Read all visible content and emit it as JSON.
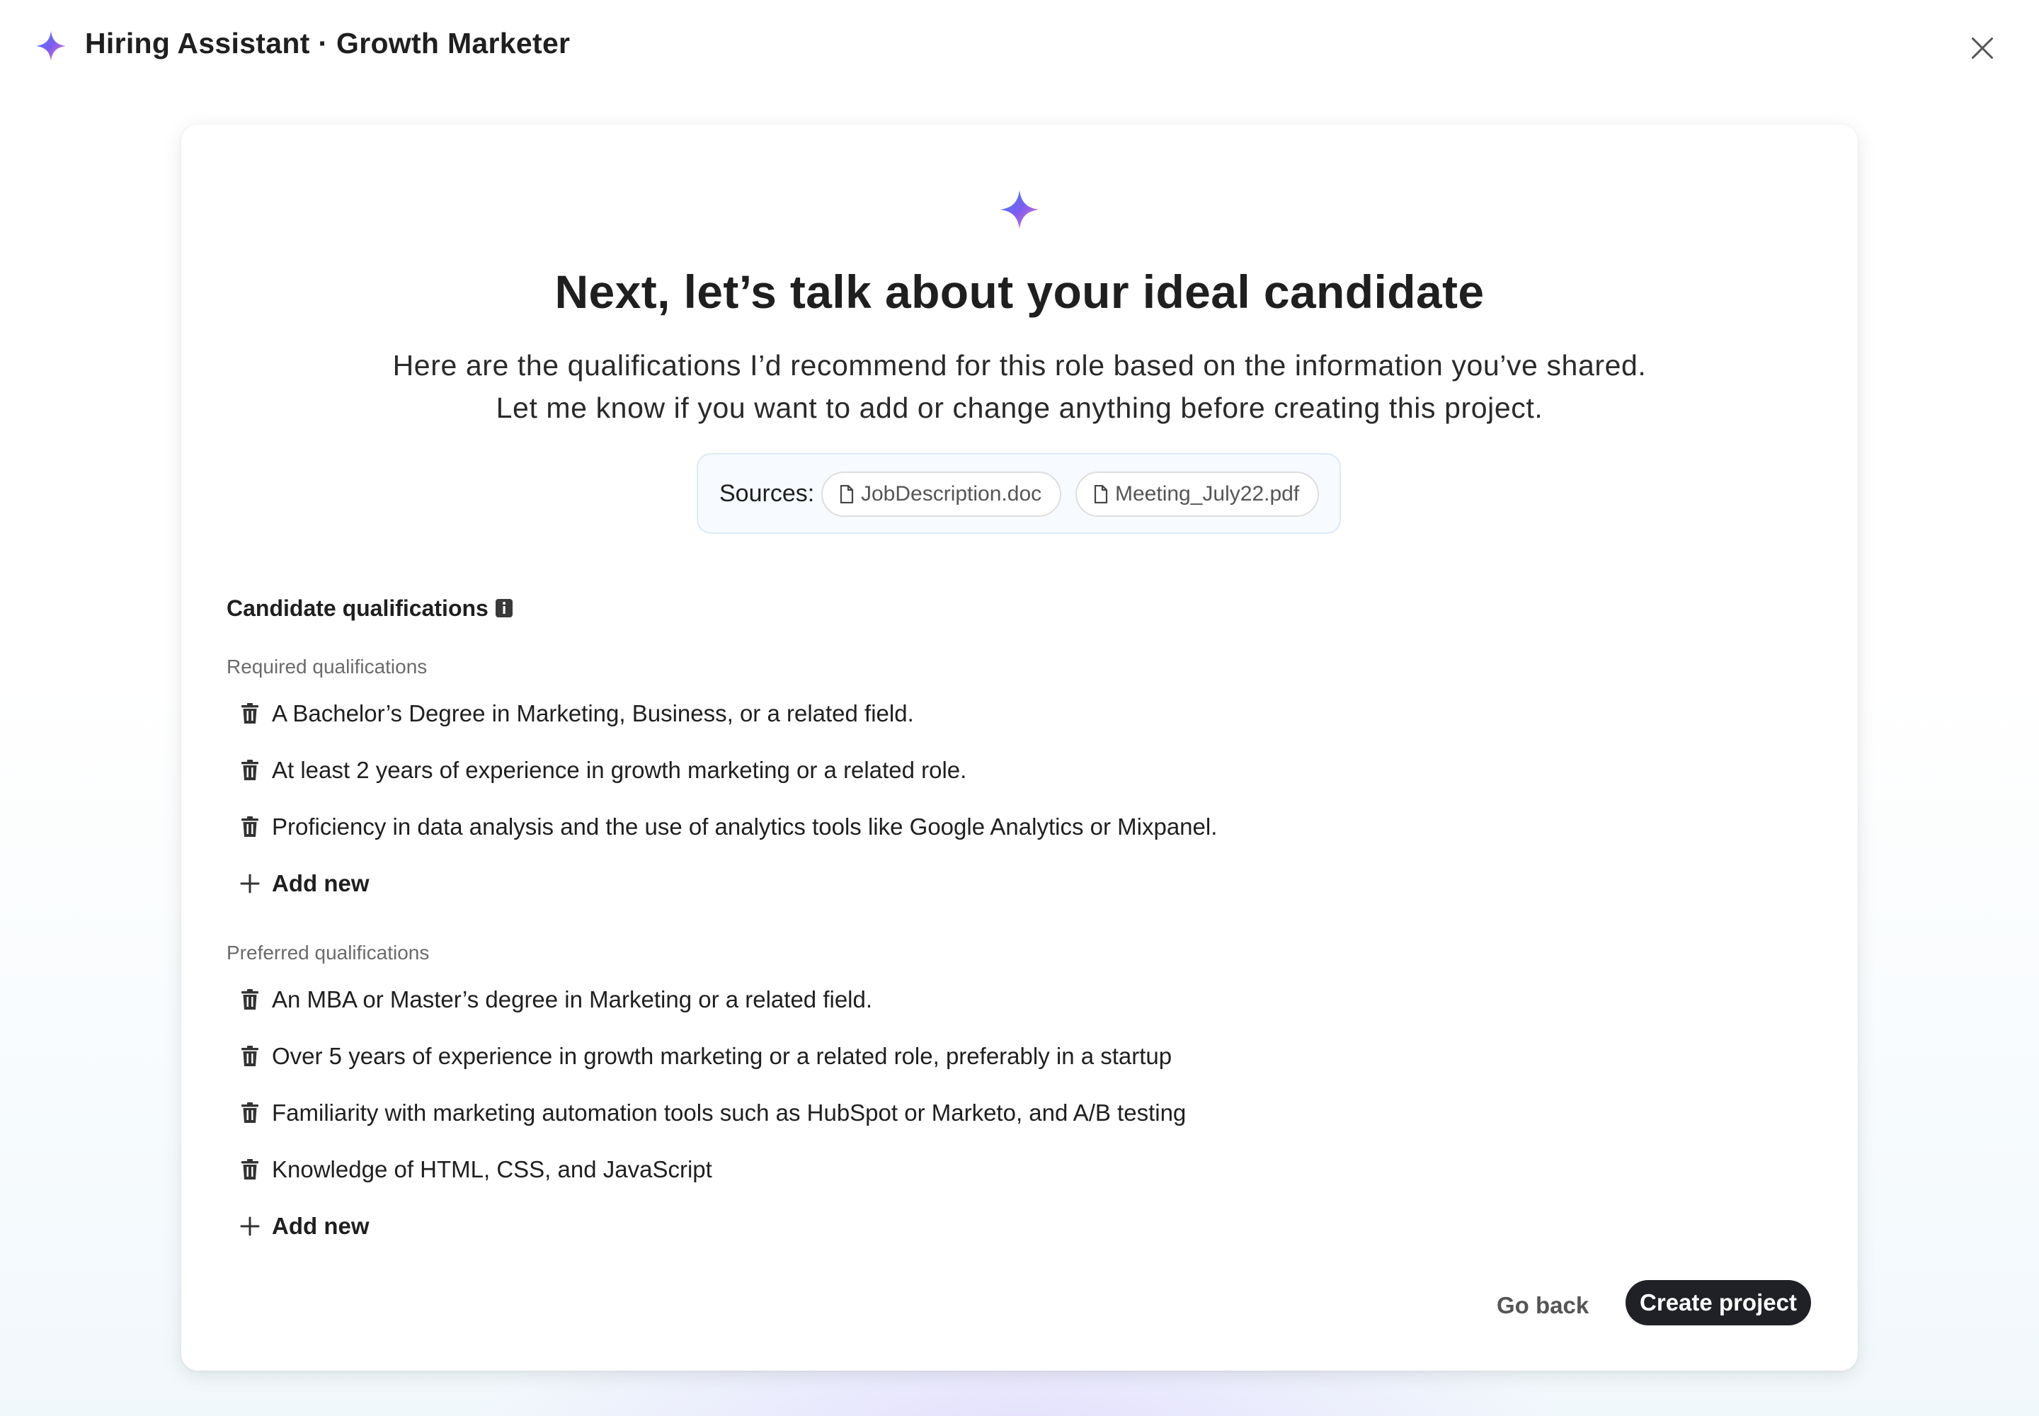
{
  "header": {
    "title": "Hiring Assistant · Growth Marketer",
    "logo_icon": "sparkle-icon",
    "close_icon": "close-icon"
  },
  "colors": {
    "spark_gradient": [
      "#4e7bff",
      "#a45cf0",
      "#ff8a3d"
    ],
    "primary_button": "#1f2126",
    "text": "#1f1f1f",
    "muted": "#6b6b6b"
  },
  "main": {
    "heading": "Next, let’s talk about your ideal candidate",
    "subtext": "Here are the qualifications I’d recommend for this role based on the information you’ve shared. Let me know if you want to add or change anything before creating this project.",
    "sources": {
      "label": "Sources:",
      "files": [
        "JobDescription.doc",
        "Meeting_July22.pdf"
      ]
    },
    "qualifications": {
      "title": "Candidate qualifications",
      "required": {
        "label": "Required qualifications",
        "items": [
          "A Bachelor’s Degree in Marketing, Business, or a related field.",
          "At least 2 years of experience in growth marketing or a related role.",
          "Proficiency in data analysis and the use of analytics tools like Google Analytics or Mixpanel."
        ],
        "add_label": "Add new"
      },
      "preferred": {
        "label": "Preferred qualifications",
        "items": [
          "An MBA or Master’s degree in Marketing or a related field.",
          "Over 5 years of experience in growth marketing or a related role, preferably in a startup",
          "Familiarity with marketing automation tools such as HubSpot or Marketo, and A/B testing",
          "Knowledge of HTML, CSS, and JavaScript"
        ],
        "add_label": "Add new"
      }
    }
  },
  "footer": {
    "back_label": "Go back",
    "create_label": "Create project"
  }
}
